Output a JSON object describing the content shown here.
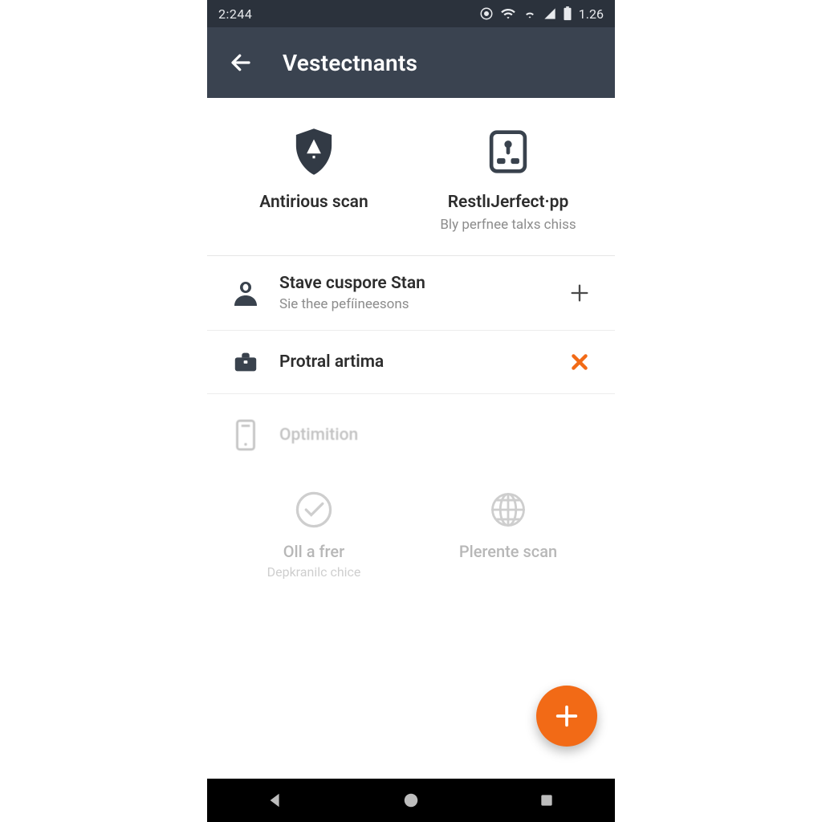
{
  "colors": {
    "accent": "#f26a16",
    "appbar": "#3a4350",
    "statusbar": "#2b323c",
    "textDark": "#2d2d2d",
    "textMuted": "#8c8c8c"
  },
  "statusbar": {
    "time": "2:244",
    "battery_label": "1.26"
  },
  "appbar": {
    "title": "Vestectnants",
    "back_icon": "arrow-left-icon"
  },
  "tiles": [
    {
      "icon": "shield-alert-icon",
      "label": "Antirious scan",
      "sub": ""
    },
    {
      "icon": "device-locate-icon",
      "label": "RestlıJerfect·pp",
      "sub": "Bly perfnee talxs chiss"
    }
  ],
  "rows": [
    {
      "icon": "person-icon",
      "title": "Stave cuspore Stan",
      "sub": "Sie thee pefíineesons",
      "action": "plus-icon",
      "action_color": "#4a4a4a"
    },
    {
      "icon": "briefcase-icon",
      "title": "Protral artima",
      "sub": "",
      "action": "close-icon",
      "action_color": "#f26a16"
    },
    {
      "icon": "device-icon",
      "title": "Optimition",
      "sub": "",
      "action": "",
      "muted": true
    }
  ],
  "tiles2": [
    {
      "icon": "check-circle-icon",
      "label": "Oll a frer",
      "sub": "Depkranilc chice"
    },
    {
      "icon": "globe-icon",
      "label": "Plerente scan",
      "sub": ""
    }
  ],
  "fab": {
    "icon": "plus-icon"
  },
  "navbar": {
    "back": "nav-back-icon",
    "home": "nav-home-icon",
    "recent": "nav-recent-icon"
  }
}
